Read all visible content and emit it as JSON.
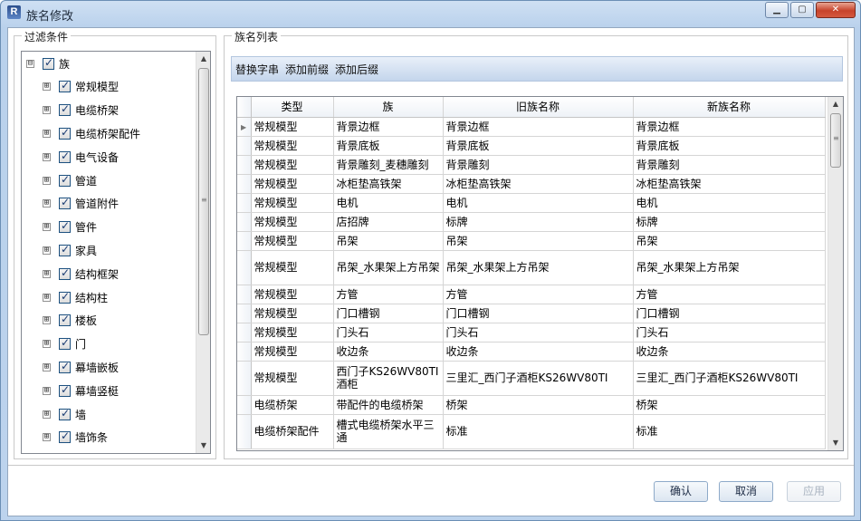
{
  "window": {
    "title": "族名修改",
    "app_icon_letter": "R"
  },
  "window_controls": {
    "minimize": "▁",
    "maximize": "▢",
    "close": "✕"
  },
  "filter": {
    "group_label": "过滤条件",
    "root": {
      "label": "族",
      "expander": "⊟"
    },
    "items": [
      {
        "label": "常规模型",
        "expander": "⊞"
      },
      {
        "label": "电缆桥架",
        "expander": "⊞"
      },
      {
        "label": "电缆桥架配件",
        "expander": "⊞"
      },
      {
        "label": "电气设备",
        "expander": "⊞"
      },
      {
        "label": "管道",
        "expander": "⊞"
      },
      {
        "label": "管道附件",
        "expander": "⊞"
      },
      {
        "label": "管件",
        "expander": "⊞"
      },
      {
        "label": "家具",
        "expander": "⊞"
      },
      {
        "label": "结构框架",
        "expander": "⊞"
      },
      {
        "label": "结构柱",
        "expander": "⊞"
      },
      {
        "label": "楼板",
        "expander": "⊞"
      },
      {
        "label": "门",
        "expander": "⊞"
      },
      {
        "label": "幕墙嵌板",
        "expander": "⊞"
      },
      {
        "label": "幕墙竖梃",
        "expander": "⊞"
      },
      {
        "label": "墙",
        "expander": "⊞"
      },
      {
        "label": "墙饰条",
        "expander": "⊞"
      }
    ]
  },
  "list": {
    "group_label": "族名列表",
    "toolbar": [
      "替换字串",
      "添加前缀",
      "添加后缀"
    ],
    "columns": [
      "类型",
      "族",
      "旧族名称",
      "新族名称"
    ],
    "rows": [
      [
        "常规模型",
        "背景边框",
        "背景边框",
        "背景边框"
      ],
      [
        "常规模型",
        "背景底板",
        "背景底板",
        "背景底板"
      ],
      [
        "常规模型",
        "背景雕刻_麦穗雕刻",
        "背景雕刻",
        "背景雕刻"
      ],
      [
        "常规模型",
        "冰柜垫高铁架",
        "冰柜垫高铁架",
        "冰柜垫高铁架"
      ],
      [
        "常规模型",
        "电机",
        "电机",
        "电机"
      ],
      [
        "常规模型",
        "店招牌",
        "标牌",
        "标牌"
      ],
      [
        "常规模型",
        "吊架",
        "吊架",
        "吊架"
      ],
      [
        "常规模型",
        "吊架_水果架上方吊架",
        "吊架_水果架上方吊架",
        "吊架_水果架上方吊架"
      ],
      [
        "常规模型",
        "方管",
        "方管",
        "方管"
      ],
      [
        "常规模型",
        "门口槽钢",
        "门口槽钢",
        "门口槽钢"
      ],
      [
        "常规模型",
        "门头石",
        "门头石",
        "门头石"
      ],
      [
        "常规模型",
        "收边条",
        "收边条",
        "收边条"
      ],
      [
        "常规模型",
        "西门子KS26WV80TI酒柜",
        "三里汇_西门子酒柜KS26WV80TI",
        "三里汇_西门子酒柜KS26WV80TI"
      ],
      [
        "电缆桥架",
        "带配件的电缆桥架",
        "桥架",
        "桥架"
      ],
      [
        "电缆桥架配件",
        "槽式电缆桥架水平三通",
        "标准",
        "标准"
      ]
    ],
    "current_row_marker": "▶"
  },
  "buttons": {
    "ok": "确认",
    "cancel": "取消",
    "apply": "应用"
  },
  "scroll_glyphs": {
    "up": "▲",
    "down": "▼",
    "grip": "≡"
  }
}
